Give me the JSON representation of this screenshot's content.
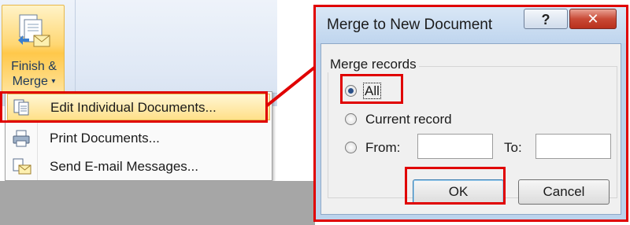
{
  "ribbon": {
    "finish_merge_line1": "Finish &",
    "finish_merge_line2": "Merge",
    "dropdown_arrow": "▾",
    "menu": [
      {
        "label": "Edit Individual Documents...",
        "icon": "edit-document-icon",
        "highlighted": true
      },
      {
        "label": "Print Documents...",
        "icon": "printer-icon",
        "highlighted": false
      },
      {
        "label": "Send E-mail Messages...",
        "icon": "email-icon",
        "highlighted": false
      }
    ]
  },
  "dialog": {
    "title": "Merge to New Document",
    "help_label": "?",
    "close_label": "✕",
    "group_label": "Merge records",
    "options": {
      "all": "All",
      "current": "Current record",
      "from": "From:",
      "to": "To:"
    },
    "selected_option": "all",
    "from_value": "",
    "to_value": "",
    "ok_label": "OK",
    "cancel_label": "Cancel"
  },
  "colors": {
    "annotation": "#e00000",
    "highlight": "#ffe089",
    "dialog_frame": "#bcd3ec"
  }
}
